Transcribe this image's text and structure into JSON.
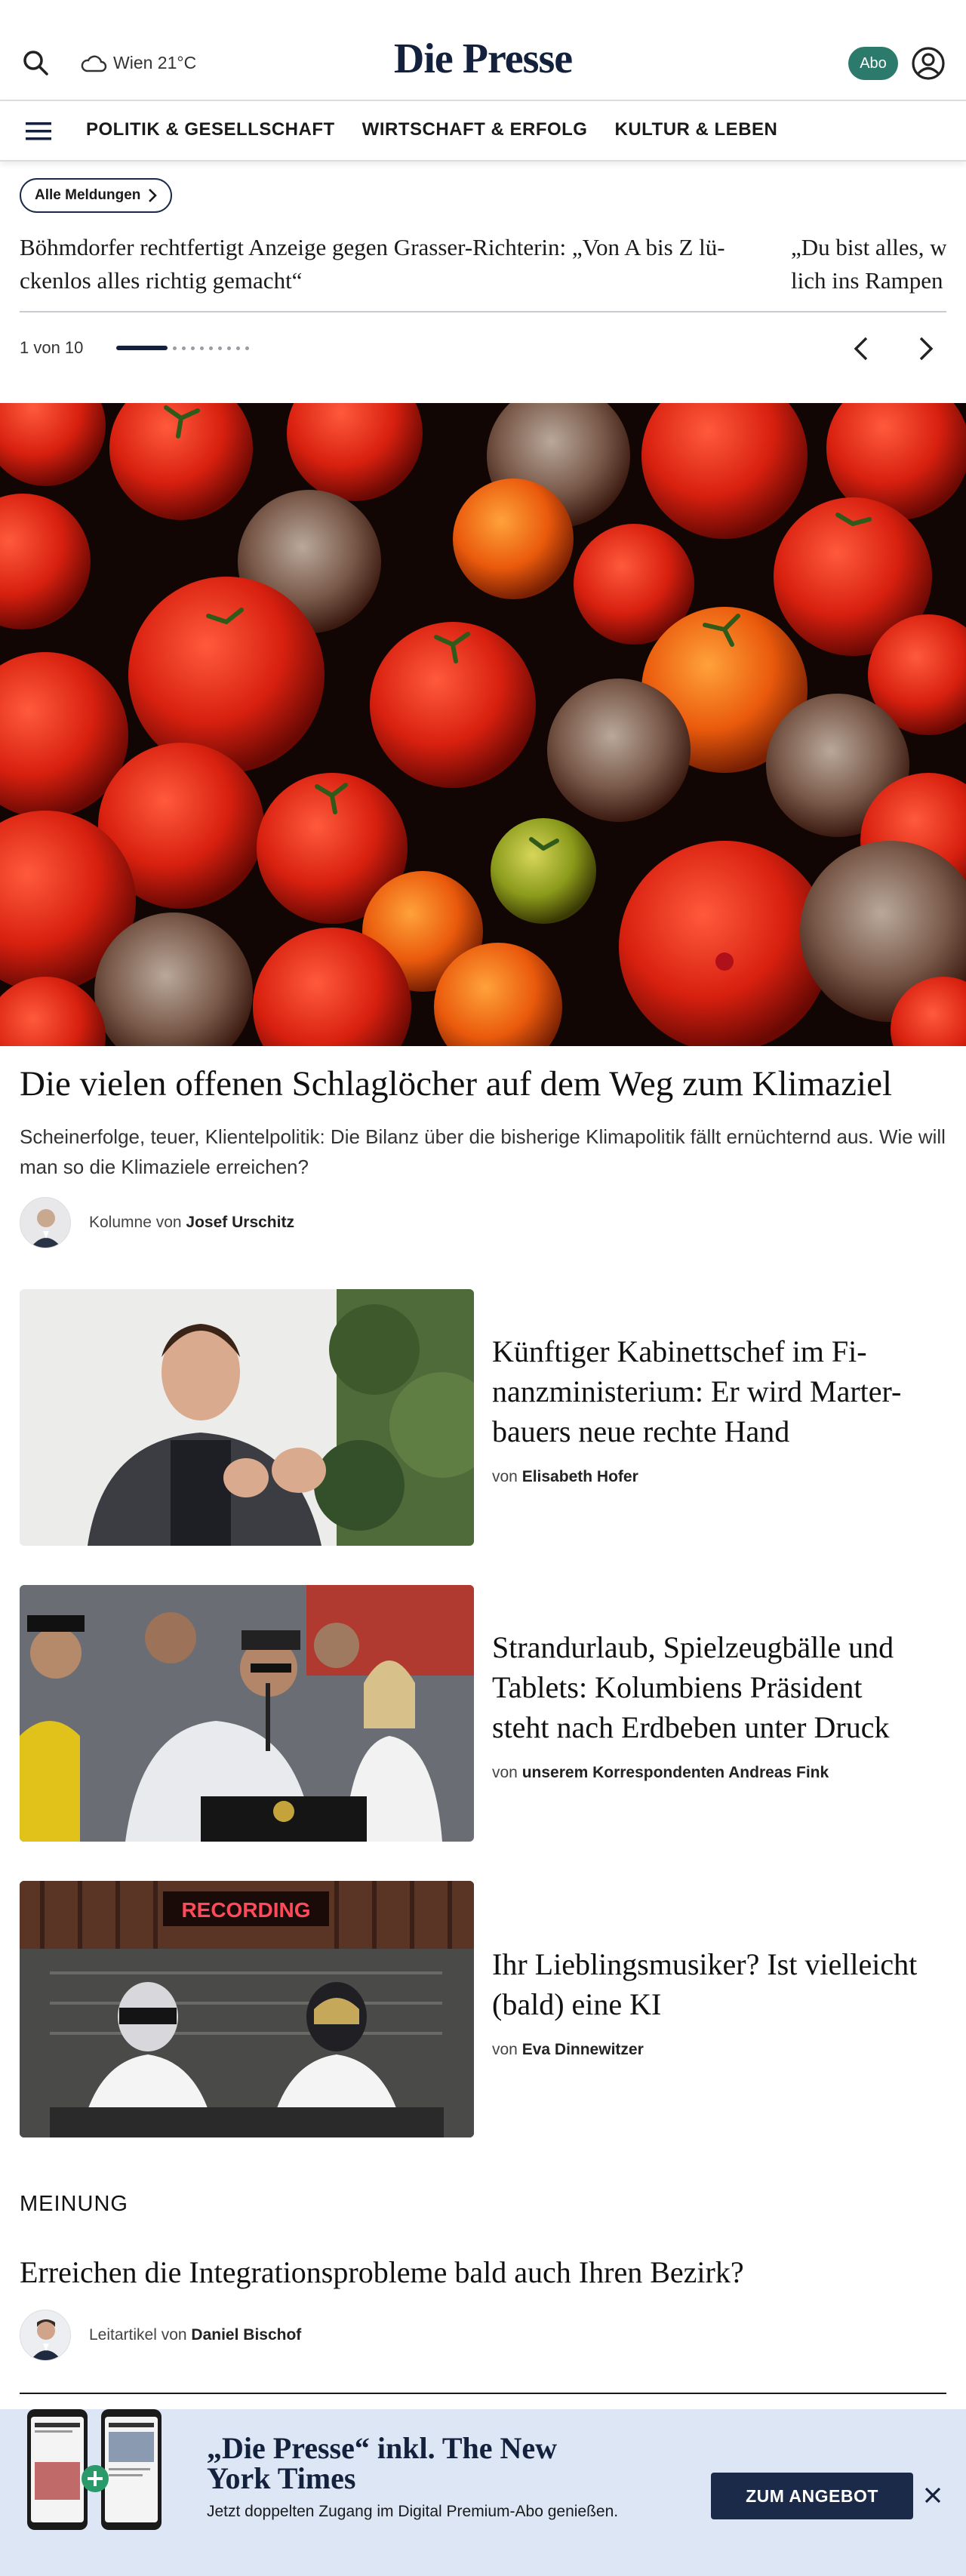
{
  "header": {
    "weather_text": "Wien 21°C",
    "logo": "Die Presse",
    "abo_label": "Abo"
  },
  "nav": {
    "items": [
      "POLITIK & GESELLSCHAFT",
      "WIRTSCHAFT & ERFOLG",
      "KULTUR & LEBEN"
    ]
  },
  "ticker": {
    "all_label": "Alle Meldungen",
    "items": [
      "Böhmdorfer rechtfertigt Anzeige gegen Grasser-Richterin: „Von A bis Z lückenlos alles richtig gemacht“",
      "„Du bist alles, wirklich ins Rampenlicht"
    ],
    "item1_line1": "Böhmdorfer rechtfertigt Anzeige gegen Grasser-Richterin: „Von A bis Z lü-",
    "item1_line2": "ckenlos alles richtig gemacht“",
    "item2_line1": "„Du bist alles, w",
    "item2_line2": "lich ins Rampen",
    "pager": "1 von 10",
    "current_page": 1,
    "total_pages": 10
  },
  "hero": {
    "title": "Die vielen offenen Schlaglöcher auf dem Weg zum Klimaziel",
    "teaser": "Scheinerfolge, teuer, Klientelpolitik: Die Bilanz über die bisherige Klimapolitik fällt ernüchternd aus. Wie will man so die Klimaziele erreichen?",
    "byline_prefix": "Kolumne von",
    "author": "Josef Urschitz"
  },
  "articles": [
    {
      "headline_l1": "Künftiger Kabinettschef im Fi-",
      "headline_l2": "nanzministerium: Er wird Marter-",
      "headline_l3": "bauers neue rechte Hand",
      "byline_prefix": "von",
      "author": "Elisabeth Hofer"
    },
    {
      "headline_l1": "Strandurlaub, Spielzeugbälle und",
      "headline_l2": "Tablets: Kolumbiens Präsident",
      "headline_l3": "steht nach Erdbeben unter Druck",
      "byline_prefix": "von",
      "author": "unserem Korrespondenten Andreas Fink"
    },
    {
      "headline_l1": "Ihr Lieblingsmusiker? Ist vielleicht",
      "headline_l2": "(bald) eine KI",
      "byline_prefix": "von",
      "author": "Eva Dinnewitzer",
      "image_sign": "RECORDING"
    }
  ],
  "opinion": {
    "section": "MEINUNG",
    "title": "Erreichen die Integrationsprobleme bald auch Ihren Bezirk?",
    "byline_prefix": "Leitartikel von",
    "author": "Daniel Bischof"
  },
  "promo": {
    "title_l1": "„Die Presse“ inkl. The New",
    "title_l2": "York Times",
    "text": "Jetzt doppelten Zugang im Digital Premium-Abo genießen.",
    "button": "ZUM ANGEBOT"
  },
  "colors": {
    "brand": "#14213d",
    "abo": "#2b7a6b",
    "promo_bg": "#dde6f5",
    "promo_button": "#1c2a4a"
  },
  "icons": [
    "search-icon",
    "cloud-icon",
    "user-icon",
    "hamburger-menu-icon",
    "chevron-right-icon",
    "chevron-left-icon",
    "close-icon",
    "plus-icon"
  ]
}
